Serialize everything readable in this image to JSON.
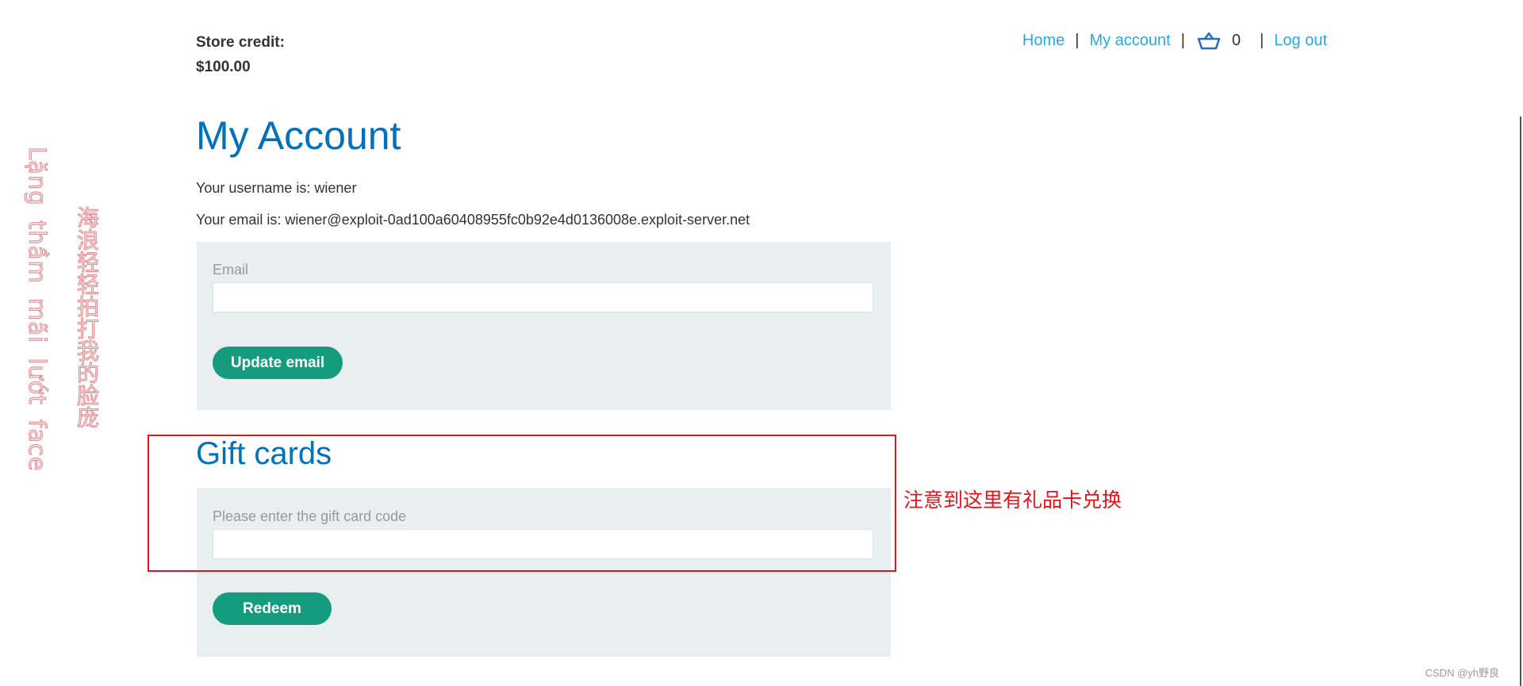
{
  "header": {
    "store_credit_label": "Store credit:",
    "store_credit_value": "$100.00",
    "nav": {
      "home": "Home",
      "my_account": "My account",
      "separator": "|",
      "cart_icon": "basket-icon",
      "cart_count": "0",
      "log_out": "Log out"
    }
  },
  "main": {
    "title": "My Account",
    "username_line": "Your username is: wiener",
    "email_line": "Your email is: wiener@exploit-0ad100a60408955fc0b92e4d0136008e.exploit-server.net",
    "email_form": {
      "label": "Email",
      "value": "",
      "button": "Update email"
    },
    "gift_cards": {
      "title": "Gift cards",
      "label": "Please enter the gift card code",
      "value": "",
      "button": "Redeem"
    }
  },
  "annotation": {
    "note": "注意到这里有礼品卡兑换",
    "color": "#e4141b"
  },
  "watermark": {
    "line1": "Lặng thầm mãi lướt face",
    "line2": "海浪轻轻拍打我的脸庞",
    "credit": "CSDN @yh野良"
  },
  "colors": {
    "heading": "#0071bc",
    "link": "#29a9e1",
    "button": "#159c7f",
    "panel": "#e9eef1"
  }
}
